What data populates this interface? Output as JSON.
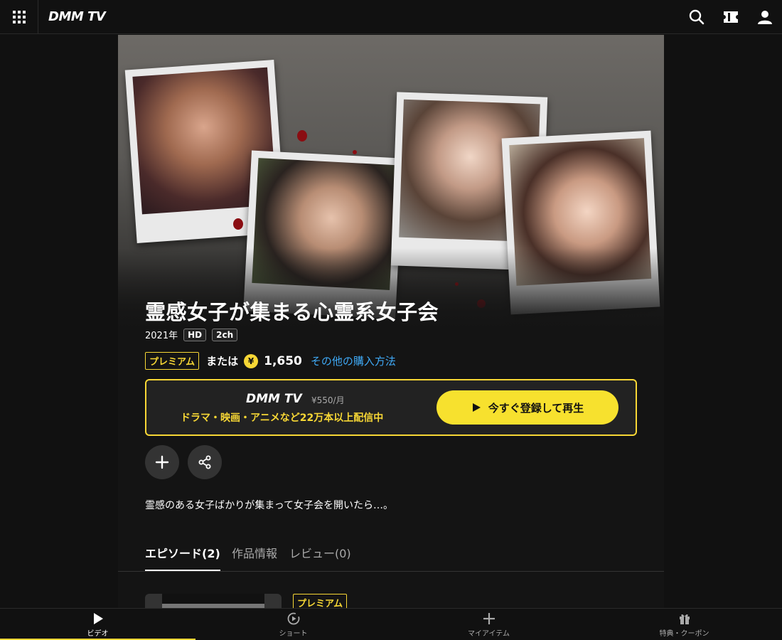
{
  "header": {
    "logo": "DMM TV",
    "icons": [
      "grid-menu-icon",
      "search-icon",
      "ticket-icon",
      "user-icon"
    ]
  },
  "work": {
    "title": "霊感女子が集まる心霊系女子会",
    "year": "2021年",
    "tags": [
      "HD",
      "2ch"
    ],
    "premium_label": "プレミアム",
    "or_label": "または",
    "yen_symbol": "¥",
    "price": "1,650",
    "other_purchase_link": "その他の購入方法",
    "description": "霊感のある女子ばかりが集まって女子会を開いたら…。"
  },
  "promo": {
    "logo": "DMM TV",
    "monthly_price": "¥550/月",
    "text": "ドラマ・映画・アニメなど22万本以上配信中",
    "button_label": "今すぐ登録して再生"
  },
  "tabs": [
    {
      "label": "エピソード(2)",
      "active": true
    },
    {
      "label": "作品情報",
      "active": false
    },
    {
      "label": "レビュー(0)",
      "active": false
    }
  ],
  "episode": {
    "badge": "プレミアム"
  },
  "bottom_nav": [
    {
      "label": "ビデオ",
      "icon": "play-icon",
      "active": true
    },
    {
      "label": "ショート",
      "icon": "short-play-icon",
      "active": false
    },
    {
      "label": "マイアイテム",
      "icon": "plus-icon",
      "active": false
    },
    {
      "label": "特典・クーポン",
      "icon": "gift-icon",
      "active": false
    }
  ],
  "colors": {
    "accent_yellow": "#f7d735",
    "button_yellow": "#f7e12e",
    "link_blue": "#3fa9f5",
    "background": "#111111"
  }
}
